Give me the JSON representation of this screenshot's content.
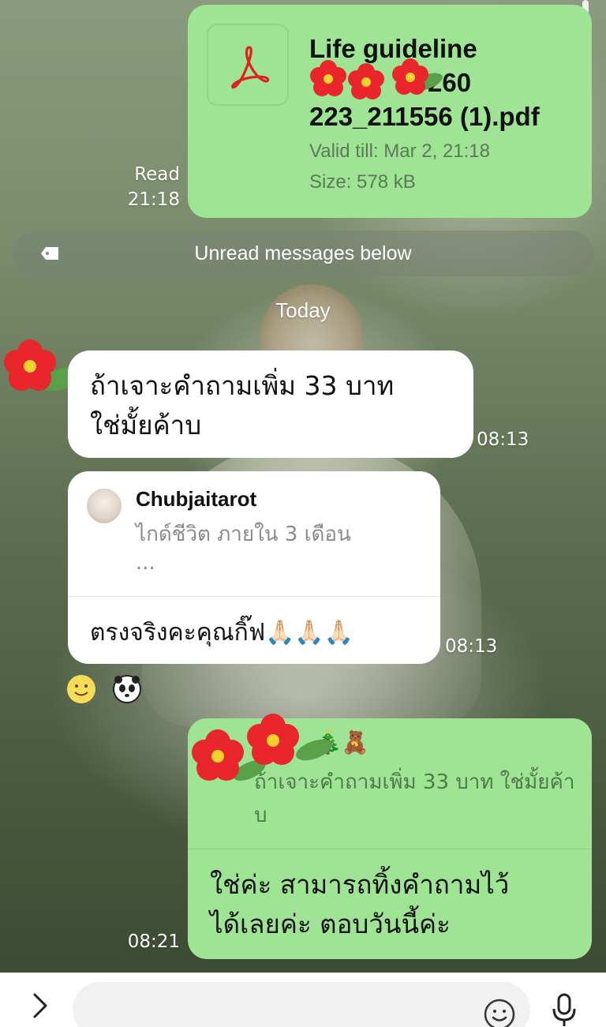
{
  "pdf_message": {
    "file_name_line1": "Life guideline",
    "file_name_line2": "260",
    "file_name_line3": "223_211556 (1).pdf",
    "valid_till": "Valid till: Mar 2, 21:18",
    "size": "Size: 578 kB",
    "read_status": "Read",
    "time": "21:18"
  },
  "unread_banner": {
    "label": "Unread messages below"
  },
  "date_separator": {
    "label": "Today"
  },
  "incoming_message_1": {
    "line1": "ถ้าเจาะคำถามเพิ่ม 33 บาท",
    "line2": "ใช่มั้ยค้าบ",
    "time": "08:13"
  },
  "incoming_message_2": {
    "reply_name": "Chubjaitarot",
    "reply_quote_line1": "ไกด์ชีวิต ภายใน 3 เดือน",
    "reply_quote_line2": "...",
    "text": "ตรงจริงคะคุณกิ๊ฟ🙏🏻🙏🏻🙏🏻",
    "time": "08:13"
  },
  "outgoing_message": {
    "quote_emoji": "🎄🧸",
    "quote_text": "ถ้าเจาะคำถามเพิ่ม 33 บาท ใช่มั้ยค้าบ",
    "line1": "ใช่ค่ะ สามารถทิ้งคำถามไว้",
    "line2": "ได้เลยค่ะ ตอบวันนี้ค่ะ",
    "time": "08:21"
  },
  "reactions": [
    "smile-emoji",
    "panda-sticker"
  ],
  "input_bar": {
    "placeholder": ""
  },
  "colors": {
    "outgoing_bubble": "#9fe394",
    "incoming_bubble": "#ffffff",
    "pdf_red": "#e02020",
    "flower_red": "#e8262c"
  }
}
